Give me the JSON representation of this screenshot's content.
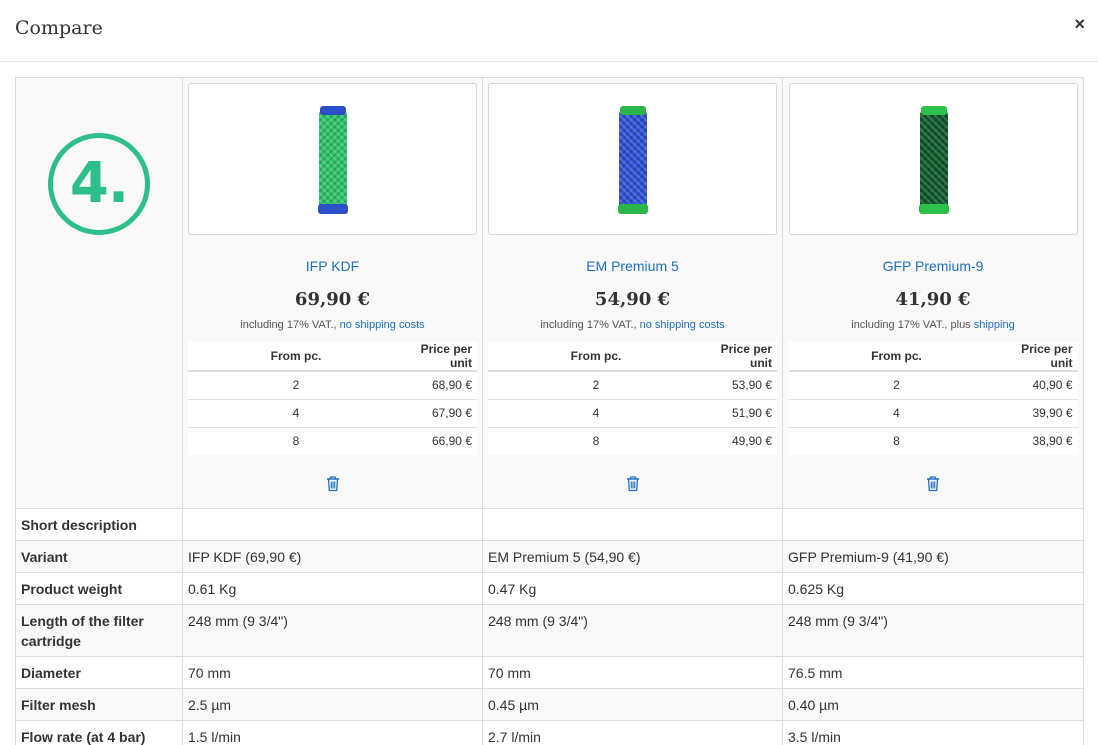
{
  "dialog": {
    "title": "Compare",
    "close_label": "×"
  },
  "badge": {
    "text": "4.",
    "color": "#2dbf8a"
  },
  "link_color": "#1f6fbf",
  "tier_headers": {
    "from": "From pc.",
    "price": "Price per unit"
  },
  "products": [
    {
      "name": "IFP KDF",
      "price": "69,90 €",
      "vat_text": "including 17% VAT., ",
      "vat_link": "no shipping costs",
      "cartridge_colors": {
        "body": "#2ec46a",
        "caps": "#2a4fc9"
      },
      "tiers": [
        {
          "from": "2",
          "price": "68,90 €"
        },
        {
          "from": "4",
          "price": "67,90 €"
        },
        {
          "from": "8",
          "price": "66,90 €"
        }
      ],
      "remove_icon": "trash-icon"
    },
    {
      "name": "EM Premium 5",
      "price": "54,90 €",
      "vat_text": "including 17% VAT., ",
      "vat_link": "no shipping costs",
      "cartridge_colors": {
        "body": "#3050d8",
        "caps": "#2ab54a"
      },
      "tiers": [
        {
          "from": "2",
          "price": "53,90 €"
        },
        {
          "from": "4",
          "price": "51,90 €"
        },
        {
          "from": "8",
          "price": "49,90 €"
        }
      ],
      "remove_icon": "trash-icon"
    },
    {
      "name": "GFP Premium-9",
      "price": "41,90 €",
      "vat_text": "including 17% VAT., plus ",
      "vat_link": "shipping",
      "cartridge_colors": {
        "body": "#0f5a2c",
        "caps": "#2fc04c"
      },
      "tiers": [
        {
          "from": "2",
          "price": "40,90 €"
        },
        {
          "from": "4",
          "price": "39,90 €"
        },
        {
          "from": "8",
          "price": "38,90 €"
        }
      ],
      "remove_icon": "trash-icon"
    }
  ],
  "attributes": [
    {
      "label": "Short description",
      "values": [
        "",
        "",
        ""
      ]
    },
    {
      "label": "Variant",
      "values": [
        "IFP KDF (69,90 €)",
        "EM Premium 5 (54,90 €)",
        "GFP Premium-9 (41,90 €)"
      ]
    },
    {
      "label": "Product weight",
      "values": [
        "0.61 Kg",
        "0.47 Kg",
        "0.625 Kg"
      ]
    },
    {
      "label": "Length of the filter cartridge",
      "values": [
        "248 mm (9 3/4\")",
        "248 mm (9 3/4\")",
        "248 mm (9 3/4\")"
      ]
    },
    {
      "label": "Diameter",
      "values": [
        "70 mm",
        "70 mm",
        "76.5 mm"
      ]
    },
    {
      "label": "Filter mesh",
      "values": [
        "2.5 µm",
        "0.45 µm",
        "0.40 µm"
      ]
    },
    {
      "label": "Flow rate (at 4 bar)",
      "values": [
        "1.5 l/min",
        "2.7 l/min",
        "3.5 l/min"
      ]
    }
  ]
}
